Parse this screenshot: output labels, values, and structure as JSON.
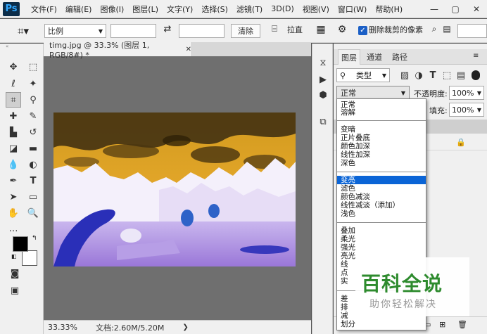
{
  "app": {
    "logo": "Ps"
  },
  "menubar": {
    "items": [
      "文件(F)",
      "编辑(E)",
      "图像(I)",
      "图层(L)",
      "文字(Y)",
      "选择(S)",
      "滤镜(T)",
      "3D(D)",
      "视图(V)",
      "窗口(W)",
      "帮助(H)"
    ]
  },
  "options": {
    "ratio_label": "比例",
    "clear_button": "清除",
    "straighten_label": "拉直",
    "delete_cropped_label": "删除裁剪的像素"
  },
  "document": {
    "tab_title": "timg.jpg @ 33.3% (图层 1, RGB/8#) *",
    "zoom": "33.33%",
    "doc_info": "文档:2.60M/5.20M"
  },
  "layers_panel": {
    "tabs": [
      "图层",
      "通道",
      "路径"
    ],
    "filter_label": "类型",
    "blend_mode_current": "正常",
    "opacity_label": "不透明度:",
    "opacity_value": "100%",
    "fill_label": "填充:",
    "fill_value": "100%"
  },
  "blend_modes": {
    "groups": [
      [
        "正常",
        "溶解"
      ],
      [
        "变暗",
        "正片叠底",
        "颜色加深",
        "线性加深",
        "深色"
      ],
      [
        "变亮",
        "滤色",
        "颜色减淡",
        "线性减淡（添加）",
        "浅色"
      ],
      [
        "叠加",
        "柔光",
        "强光",
        "亮光",
        "线",
        "点",
        "实"
      ],
      [
        "差",
        "排",
        "减",
        "划分"
      ]
    ],
    "highlighted": "变亮"
  },
  "watermark": {
    "title": "百科全说",
    "subtitle": "助你轻松解决"
  },
  "colors": {
    "accent": "#0a64d6",
    "panel_bg": "#f0f0f0",
    "canvas_bg": "#6f6f6f",
    "watermark_green": "#2e8b2e"
  },
  "icons": {
    "tools": [
      "move-icon",
      "marquee-icon",
      "lasso-icon",
      "magic-wand-icon",
      "crop-icon",
      "eyedropper-icon",
      "healing-icon",
      "brush-icon",
      "stamp-icon",
      "history-brush-icon",
      "eraser-icon",
      "gradient-icon",
      "blur-icon",
      "dodge-icon",
      "pen-icon",
      "type-icon",
      "path-select-icon",
      "rectangle-icon",
      "hand-icon",
      "zoom-icon"
    ]
  }
}
